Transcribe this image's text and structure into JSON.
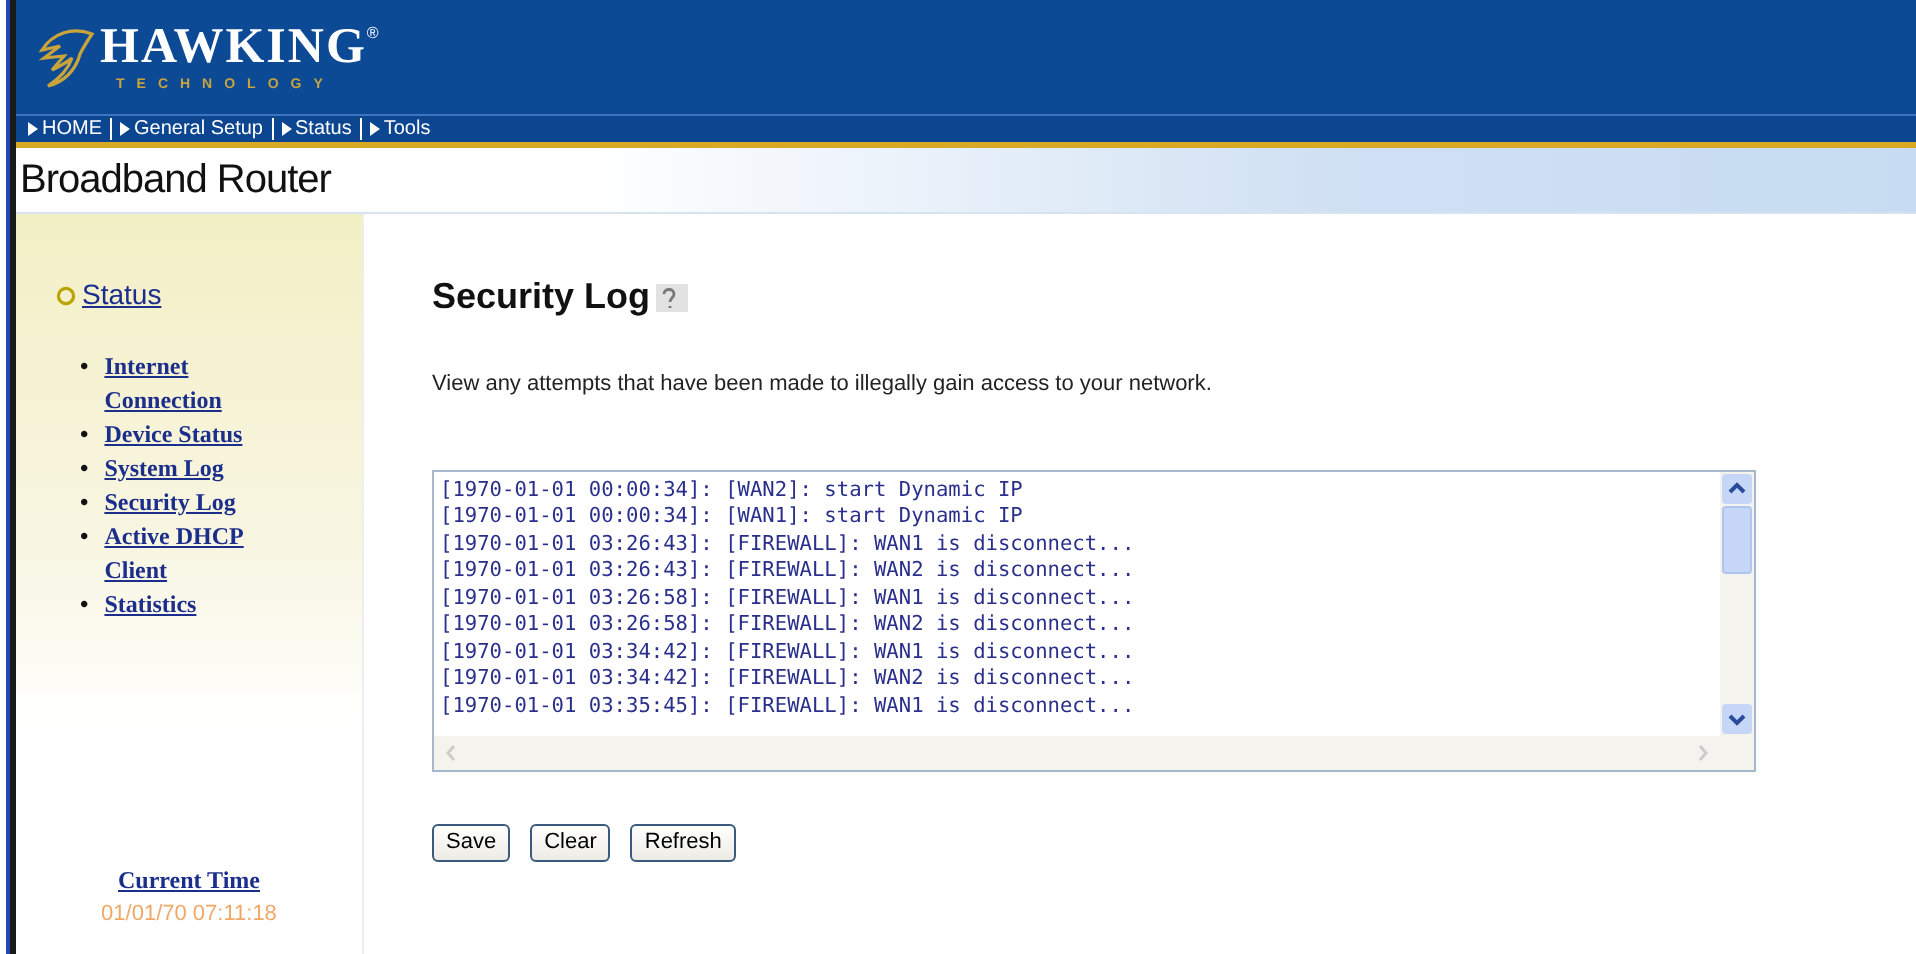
{
  "logo": {
    "name": "HAWKING",
    "registered": "®",
    "tagline": "TECHNOLOGY"
  },
  "nav": [
    {
      "label": "HOME"
    },
    {
      "label": "General Setup"
    },
    {
      "label": "Status"
    },
    {
      "label": "Tools"
    }
  ],
  "banner": {
    "title": "Broadband Router"
  },
  "sidebar": {
    "section": "Status",
    "items": [
      {
        "bullet": "•",
        "label": "Internet Connection"
      },
      {
        "bullet": "•",
        "label": "Device Status"
      },
      {
        "bullet": "•",
        "label": "System Log"
      },
      {
        "bullet": "•",
        "label": "Security Log"
      },
      {
        "bullet": "•",
        "label": "Active DHCP Client"
      },
      {
        "bullet": "•",
        "label": "Statistics"
      }
    ],
    "time_label": "Current Time",
    "time_value": "01/01/70 07:11:18"
  },
  "page": {
    "title": "Security Log",
    "description": "View any attempts that have been made to illegally gain access to your network.",
    "log_lines": [
      "[1970-01-01 00:00:34]: [WAN2]: start Dynamic IP",
      "[1970-01-01 00:00:34]: [WAN1]: start Dynamic IP",
      "[1970-01-01 03:26:43]: [FIREWALL]: WAN1 is disconnect...",
      "[1970-01-01 03:26:43]: [FIREWALL]: WAN2 is disconnect...",
      "[1970-01-01 03:26:58]: [FIREWALL]: WAN1 is disconnect...",
      "[1970-01-01 03:26:58]: [FIREWALL]: WAN2 is disconnect...",
      "[1970-01-01 03:34:42]: [FIREWALL]: WAN1 is disconnect...",
      "[1970-01-01 03:34:42]: [FIREWALL]: WAN2 is disconnect...",
      "[1970-01-01 03:35:45]: [FIREWALL]: WAN1 is disconnect..."
    ],
    "buttons": [
      "Save",
      "Clear",
      "Refresh"
    ]
  }
}
